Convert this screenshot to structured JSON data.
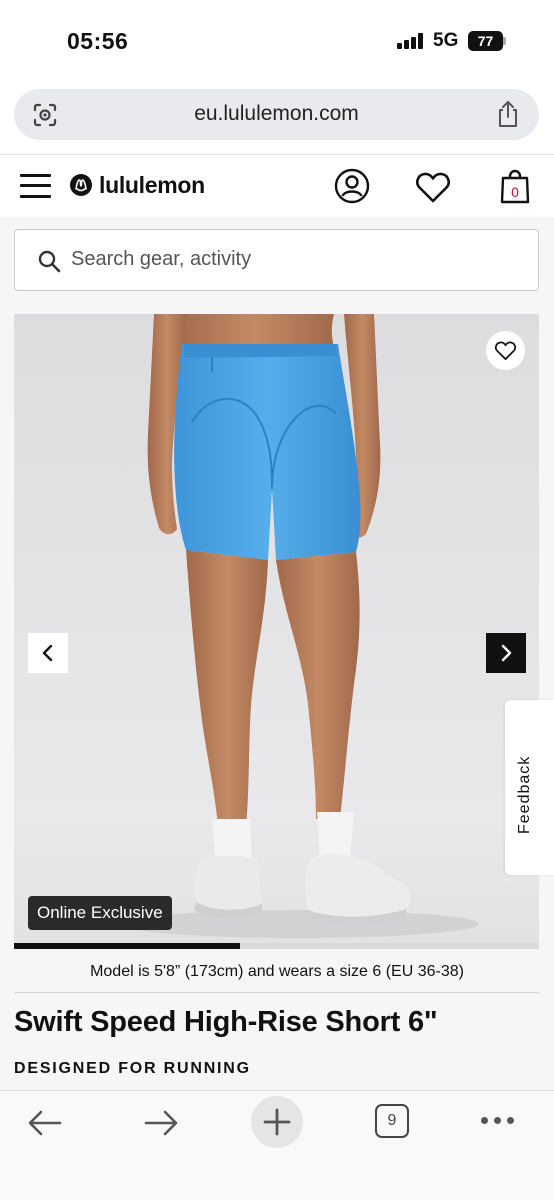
{
  "status_bar": {
    "time": "05:56",
    "network": "5G",
    "battery": "77"
  },
  "browser": {
    "url": "eu.lululemon.com",
    "open_tabs": "9"
  },
  "header": {
    "brand": "lululemon",
    "bag_count": "0"
  },
  "search": {
    "placeholder": "Search gear, activity"
  },
  "gallery": {
    "badge": "Online Exclusive",
    "progress_fraction": 0.43,
    "model_info": "Model is 5'8” (173cm) and wears a size 6 (EU 36-38)"
  },
  "feedback_tab": {
    "label": "Feedback"
  },
  "product": {
    "title": "Swift Speed High-Rise Short 6\"",
    "tag": "DESIGNED FOR RUNNING",
    "color": "#4aa3e3"
  },
  "colors": {
    "accent": "#111111",
    "bag_count": "#c8102e"
  }
}
